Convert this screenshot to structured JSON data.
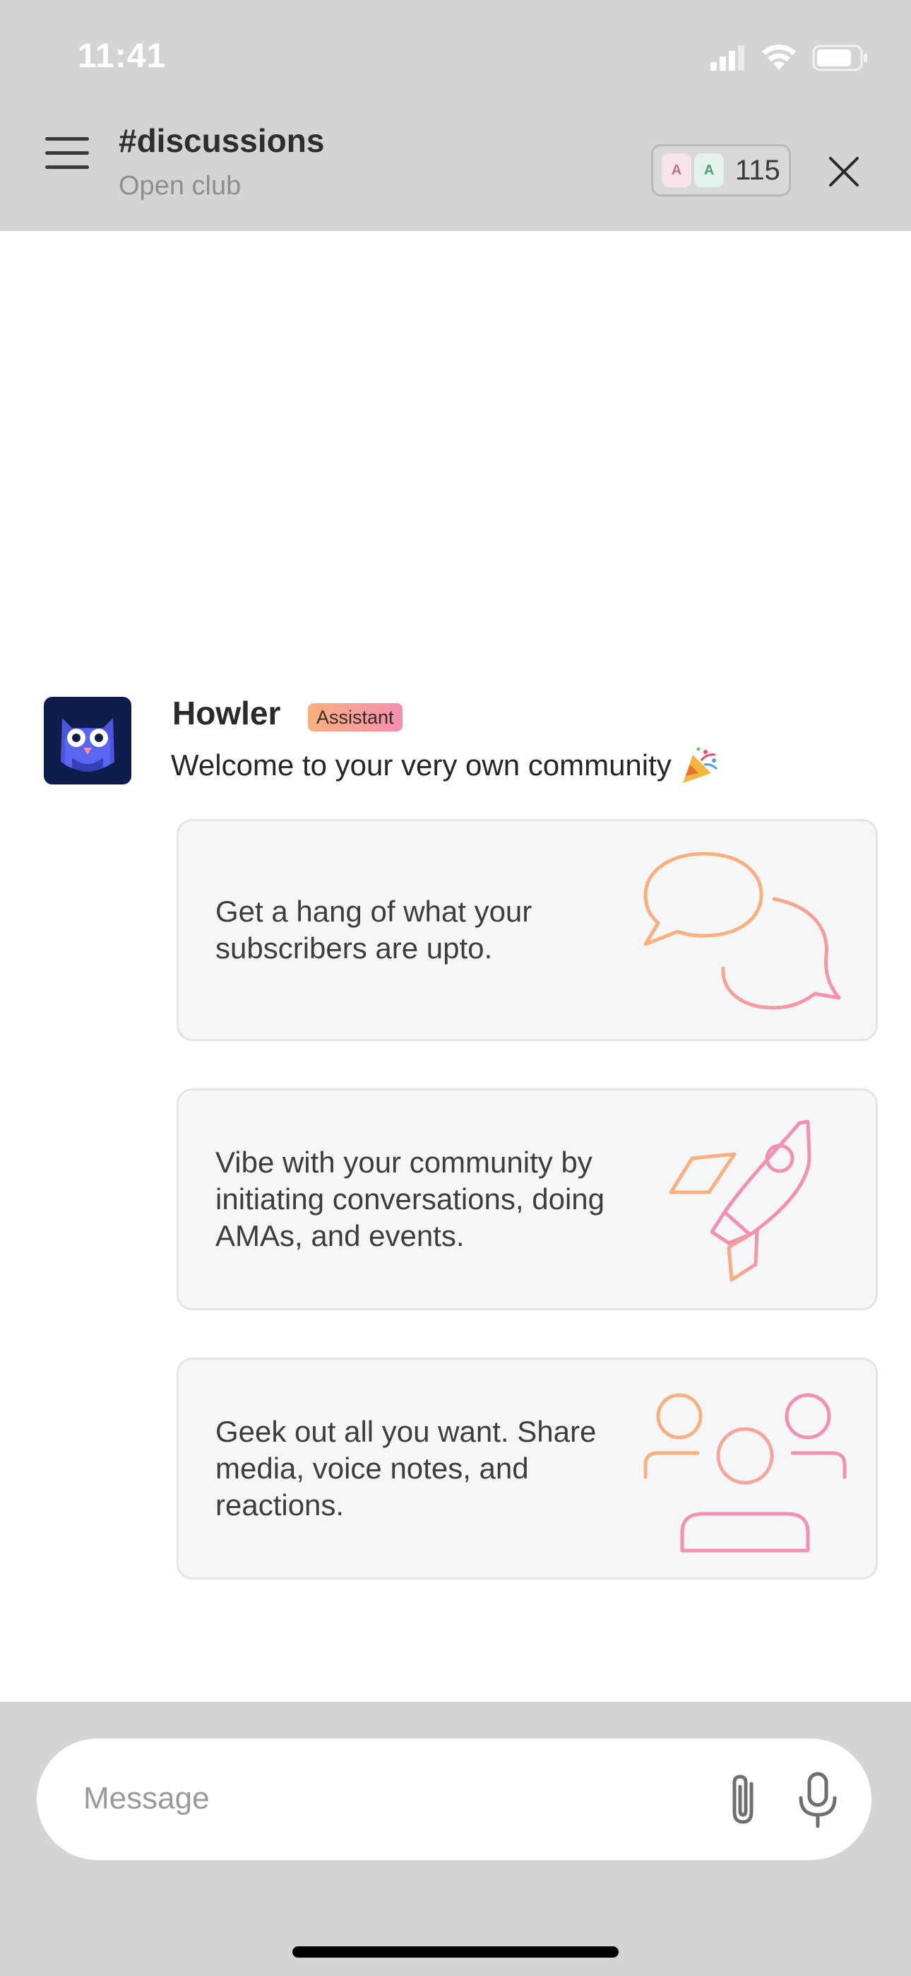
{
  "status_bar": {
    "time": "11:41"
  },
  "header": {
    "channel": "#discussions",
    "subtitle": "Open club",
    "member_avatars": [
      "A",
      "A"
    ],
    "member_count": "115"
  },
  "message": {
    "sender": "Howler",
    "badge": "Assistant",
    "text": "Welcome to your very own community",
    "emoji": "party-popper-icon"
  },
  "cards": [
    {
      "text": "Get a hang of what your subscribers are upto.",
      "icon": "chat-bubbles-icon"
    },
    {
      "text": "Vibe with your community by initiating conversations, doing AMAs, and events.",
      "icon": "rocket-icon"
    },
    {
      "text": "Geek out all you want. Share media, voice notes, and reactions.",
      "icon": "people-group-icon"
    }
  ],
  "composer": {
    "placeholder": "Message"
  },
  "colors": {
    "header_bg": "#d4d4d4",
    "accent_orange": "#f7b07e",
    "accent_pink": "#f58fb0",
    "bot_bg": "#0f1d4d"
  }
}
